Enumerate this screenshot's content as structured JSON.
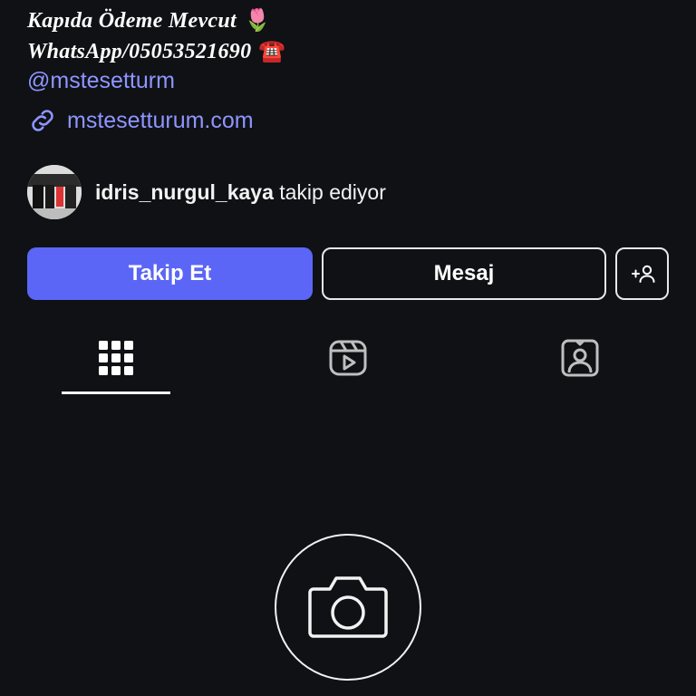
{
  "bio": {
    "line_cut": "Kapıda Ödeme Mevcut",
    "line_delivery": "Kapıda Ödeme Mevcut",
    "line_delivery_emoji": "🌷",
    "line_whatsapp": "WhatsApp/05053521690",
    "line_whatsapp_emoji": "☎️",
    "handle": "@mstesetturm",
    "link": "mstesetturum.com"
  },
  "followed_by": {
    "username": "idris_nurgul_kaya",
    "suffix": "takip ediyor"
  },
  "actions": {
    "follow_label": "Takip Et",
    "message_label": "Mesaj",
    "suggest_icon": "add-person-icon"
  },
  "tabs": [
    {
      "icon": "grid-icon",
      "active": true
    },
    {
      "icon": "reels-icon",
      "active": false
    },
    {
      "icon": "tagged-icon",
      "active": false
    }
  ],
  "empty_state": {
    "icon": "camera-icon"
  },
  "colors": {
    "background": "#0f1115",
    "accent": "#5b66f6",
    "link": "#8f95ff",
    "text": "#ffffff"
  }
}
